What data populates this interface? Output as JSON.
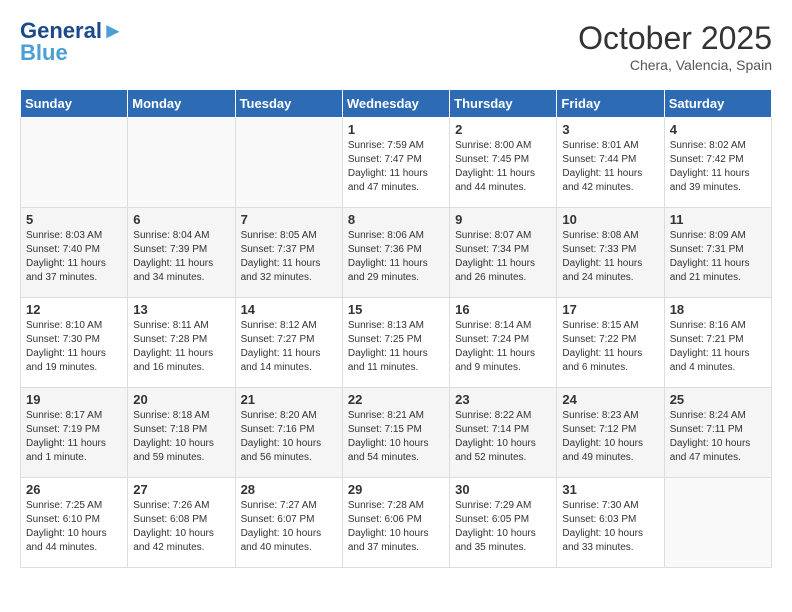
{
  "header": {
    "logo_line1": "General",
    "logo_line2": "Blue",
    "month": "October 2025",
    "location": "Chera, Valencia, Spain"
  },
  "days_of_week": [
    "Sunday",
    "Monday",
    "Tuesday",
    "Wednesday",
    "Thursday",
    "Friday",
    "Saturday"
  ],
  "weeks": [
    [
      {
        "num": "",
        "sunrise": "",
        "sunset": "",
        "daylight": ""
      },
      {
        "num": "",
        "sunrise": "",
        "sunset": "",
        "daylight": ""
      },
      {
        "num": "",
        "sunrise": "",
        "sunset": "",
        "daylight": ""
      },
      {
        "num": "1",
        "sunrise": "Sunrise: 7:59 AM",
        "sunset": "Sunset: 7:47 PM",
        "daylight": "Daylight: 11 hours and 47 minutes."
      },
      {
        "num": "2",
        "sunrise": "Sunrise: 8:00 AM",
        "sunset": "Sunset: 7:45 PM",
        "daylight": "Daylight: 11 hours and 44 minutes."
      },
      {
        "num": "3",
        "sunrise": "Sunrise: 8:01 AM",
        "sunset": "Sunset: 7:44 PM",
        "daylight": "Daylight: 11 hours and 42 minutes."
      },
      {
        "num": "4",
        "sunrise": "Sunrise: 8:02 AM",
        "sunset": "Sunset: 7:42 PM",
        "daylight": "Daylight: 11 hours and 39 minutes."
      }
    ],
    [
      {
        "num": "5",
        "sunrise": "Sunrise: 8:03 AM",
        "sunset": "Sunset: 7:40 PM",
        "daylight": "Daylight: 11 hours and 37 minutes."
      },
      {
        "num": "6",
        "sunrise": "Sunrise: 8:04 AM",
        "sunset": "Sunset: 7:39 PM",
        "daylight": "Daylight: 11 hours and 34 minutes."
      },
      {
        "num": "7",
        "sunrise": "Sunrise: 8:05 AM",
        "sunset": "Sunset: 7:37 PM",
        "daylight": "Daylight: 11 hours and 32 minutes."
      },
      {
        "num": "8",
        "sunrise": "Sunrise: 8:06 AM",
        "sunset": "Sunset: 7:36 PM",
        "daylight": "Daylight: 11 hours and 29 minutes."
      },
      {
        "num": "9",
        "sunrise": "Sunrise: 8:07 AM",
        "sunset": "Sunset: 7:34 PM",
        "daylight": "Daylight: 11 hours and 26 minutes."
      },
      {
        "num": "10",
        "sunrise": "Sunrise: 8:08 AM",
        "sunset": "Sunset: 7:33 PM",
        "daylight": "Daylight: 11 hours and 24 minutes."
      },
      {
        "num": "11",
        "sunrise": "Sunrise: 8:09 AM",
        "sunset": "Sunset: 7:31 PM",
        "daylight": "Daylight: 11 hours and 21 minutes."
      }
    ],
    [
      {
        "num": "12",
        "sunrise": "Sunrise: 8:10 AM",
        "sunset": "Sunset: 7:30 PM",
        "daylight": "Daylight: 11 hours and 19 minutes."
      },
      {
        "num": "13",
        "sunrise": "Sunrise: 8:11 AM",
        "sunset": "Sunset: 7:28 PM",
        "daylight": "Daylight: 11 hours and 16 minutes."
      },
      {
        "num": "14",
        "sunrise": "Sunrise: 8:12 AM",
        "sunset": "Sunset: 7:27 PM",
        "daylight": "Daylight: 11 hours and 14 minutes."
      },
      {
        "num": "15",
        "sunrise": "Sunrise: 8:13 AM",
        "sunset": "Sunset: 7:25 PM",
        "daylight": "Daylight: 11 hours and 11 minutes."
      },
      {
        "num": "16",
        "sunrise": "Sunrise: 8:14 AM",
        "sunset": "Sunset: 7:24 PM",
        "daylight": "Daylight: 11 hours and 9 minutes."
      },
      {
        "num": "17",
        "sunrise": "Sunrise: 8:15 AM",
        "sunset": "Sunset: 7:22 PM",
        "daylight": "Daylight: 11 hours and 6 minutes."
      },
      {
        "num": "18",
        "sunrise": "Sunrise: 8:16 AM",
        "sunset": "Sunset: 7:21 PM",
        "daylight": "Daylight: 11 hours and 4 minutes."
      }
    ],
    [
      {
        "num": "19",
        "sunrise": "Sunrise: 8:17 AM",
        "sunset": "Sunset: 7:19 PM",
        "daylight": "Daylight: 11 hours and 1 minute."
      },
      {
        "num": "20",
        "sunrise": "Sunrise: 8:18 AM",
        "sunset": "Sunset: 7:18 PM",
        "daylight": "Daylight: 10 hours and 59 minutes."
      },
      {
        "num": "21",
        "sunrise": "Sunrise: 8:20 AM",
        "sunset": "Sunset: 7:16 PM",
        "daylight": "Daylight: 10 hours and 56 minutes."
      },
      {
        "num": "22",
        "sunrise": "Sunrise: 8:21 AM",
        "sunset": "Sunset: 7:15 PM",
        "daylight": "Daylight: 10 hours and 54 minutes."
      },
      {
        "num": "23",
        "sunrise": "Sunrise: 8:22 AM",
        "sunset": "Sunset: 7:14 PM",
        "daylight": "Daylight: 10 hours and 52 minutes."
      },
      {
        "num": "24",
        "sunrise": "Sunrise: 8:23 AM",
        "sunset": "Sunset: 7:12 PM",
        "daylight": "Daylight: 10 hours and 49 minutes."
      },
      {
        "num": "25",
        "sunrise": "Sunrise: 8:24 AM",
        "sunset": "Sunset: 7:11 PM",
        "daylight": "Daylight: 10 hours and 47 minutes."
      }
    ],
    [
      {
        "num": "26",
        "sunrise": "Sunrise: 7:25 AM",
        "sunset": "Sunset: 6:10 PM",
        "daylight": "Daylight: 10 hours and 44 minutes."
      },
      {
        "num": "27",
        "sunrise": "Sunrise: 7:26 AM",
        "sunset": "Sunset: 6:08 PM",
        "daylight": "Daylight: 10 hours and 42 minutes."
      },
      {
        "num": "28",
        "sunrise": "Sunrise: 7:27 AM",
        "sunset": "Sunset: 6:07 PM",
        "daylight": "Daylight: 10 hours and 40 minutes."
      },
      {
        "num": "29",
        "sunrise": "Sunrise: 7:28 AM",
        "sunset": "Sunset: 6:06 PM",
        "daylight": "Daylight: 10 hours and 37 minutes."
      },
      {
        "num": "30",
        "sunrise": "Sunrise: 7:29 AM",
        "sunset": "Sunset: 6:05 PM",
        "daylight": "Daylight: 10 hours and 35 minutes."
      },
      {
        "num": "31",
        "sunrise": "Sunrise: 7:30 AM",
        "sunset": "Sunset: 6:03 PM",
        "daylight": "Daylight: 10 hours and 33 minutes."
      },
      {
        "num": "",
        "sunrise": "",
        "sunset": "",
        "daylight": ""
      }
    ]
  ]
}
